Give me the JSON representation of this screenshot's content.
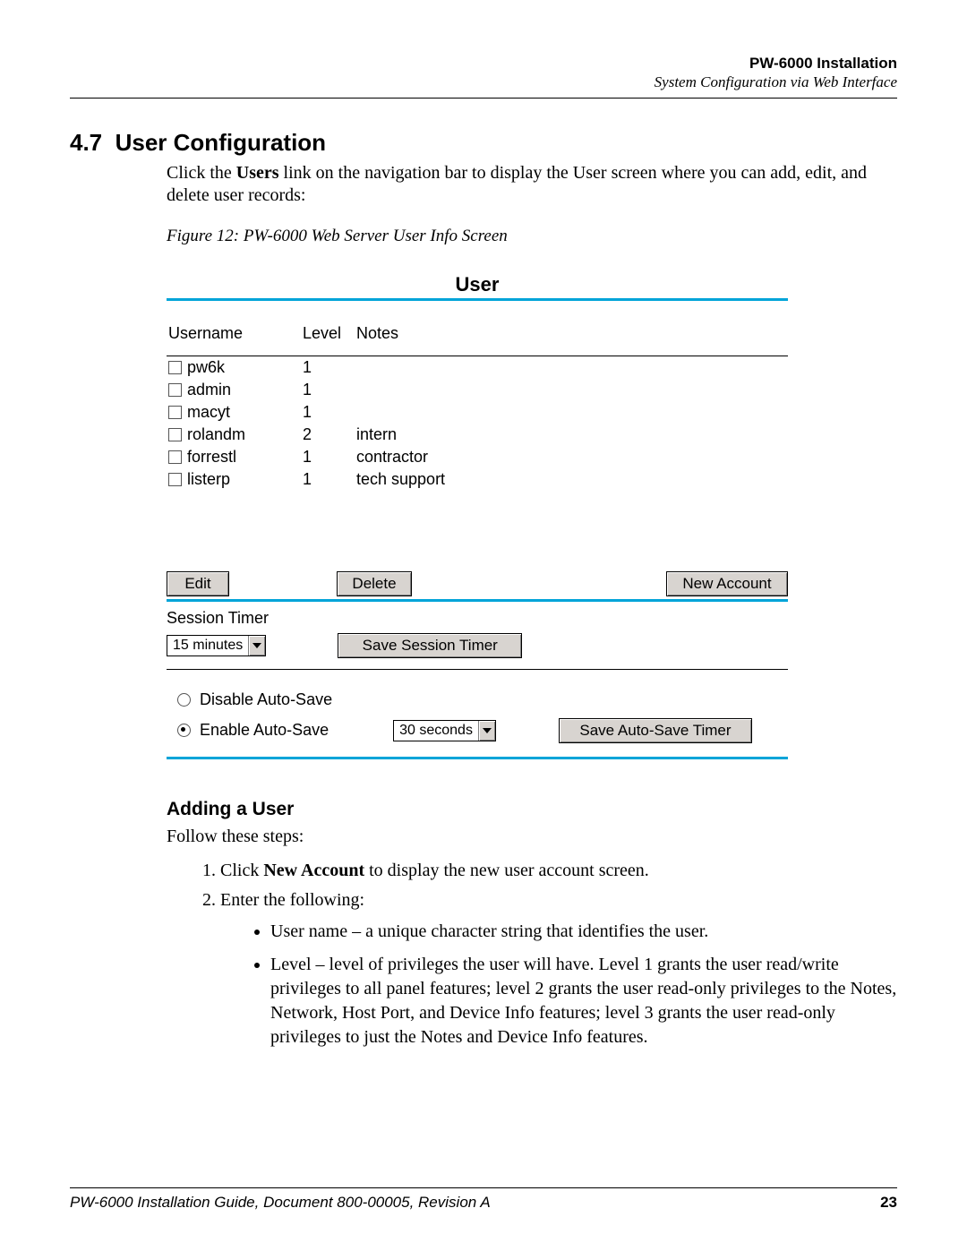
{
  "header": {
    "line1": "PW-6000 Installation",
    "line2": "System Configuration via Web Interface"
  },
  "section": {
    "number": "4.7",
    "title": "User Configuration",
    "intro_pre": "Click the ",
    "intro_link": "Users",
    "intro_post": " link on the navigation bar to display the User screen where you can add, edit, and delete user records:"
  },
  "figure_caption": "Figure 12:    PW-6000 Web Server User Info Screen",
  "panel": {
    "title": "User",
    "cols": {
      "username": "Username",
      "level": "Level",
      "notes": "Notes"
    },
    "rows": [
      {
        "username": "pw6k",
        "level": "1",
        "notes": ""
      },
      {
        "username": "admin",
        "level": "1",
        "notes": ""
      },
      {
        "username": "macyt",
        "level": "1",
        "notes": ""
      },
      {
        "username": "rolandm",
        "level": "2",
        "notes": "intern"
      },
      {
        "username": "forrestl",
        "level": "1",
        "notes": "contractor"
      },
      {
        "username": "listerp",
        "level": "1",
        "notes": "tech support"
      }
    ],
    "buttons": {
      "edit": "Edit",
      "delete": "Delete",
      "new_account": "New Account"
    },
    "session": {
      "label": "Session Timer",
      "value": "15 minutes",
      "save": "Save Session Timer"
    },
    "autosave": {
      "disable": "Disable Auto-Save",
      "enable": "Enable Auto-Save",
      "value": "30 seconds",
      "save": "Save Auto-Save Timer"
    }
  },
  "adding": {
    "title": "Adding a User",
    "intro": "Follow these steps:",
    "step1_pre": "Click ",
    "step1_bold": "New Account",
    "step1_post": " to display the new user account screen.",
    "step2": "Enter the following:",
    "bullets": {
      "b1": "User name – a unique character string that identifies the user.",
      "b2": "Level – level of privileges the user will have. Level 1 grants the user read/write privileges to all panel features; level 2 grants the user read-only privileges to the Notes, Network, Host Port, and Device Info features; level 3 grants the user read-only privileges to just the Notes and Device Info features."
    }
  },
  "footer": {
    "left": "PW-6000 Installation Guide, Document 800-00005, Revision A",
    "right": "23"
  }
}
